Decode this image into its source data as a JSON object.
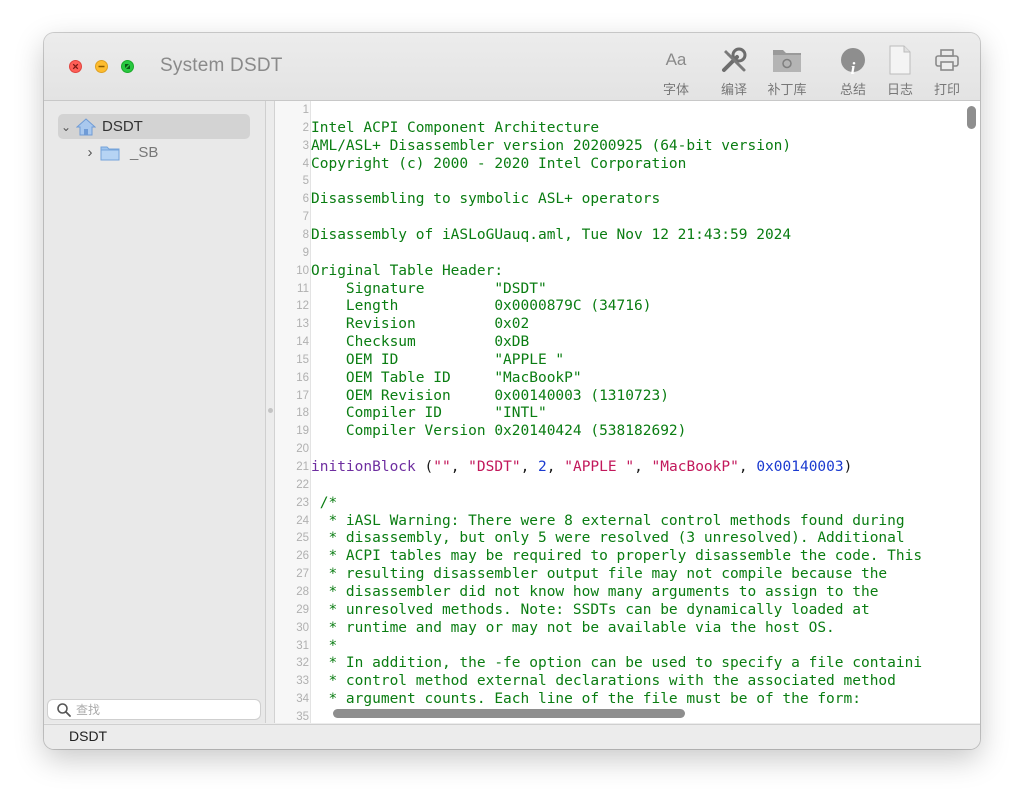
{
  "window": {
    "title": "System DSDT"
  },
  "toolbar": {
    "items": [
      {
        "label": "字体",
        "glyph": "Aa",
        "icon": "font-icon"
      },
      {
        "label": "编译",
        "icon": "wrench-screwdriver-icon"
      },
      {
        "label": "补丁库",
        "icon": "patch-folder-icon"
      },
      {
        "label": "总结",
        "glyph": "i",
        "icon": "info-icon"
      },
      {
        "label": "日志",
        "icon": "document-icon"
      },
      {
        "label": "打印",
        "icon": "printer-icon"
      }
    ]
  },
  "sidebar": {
    "tree": [
      {
        "label": "DSDT",
        "chevron": "⌄",
        "icon": "home-folder-icon"
      },
      {
        "label": "_SB",
        "chevron": "›",
        "icon": "folder-icon"
      }
    ],
    "search_placeholder": "查找"
  },
  "editor": {
    "lines": [
      {
        "n": "1",
        "segs": []
      },
      {
        "n": "2",
        "segs": [
          {
            "t": "Intel ACPI Component Architecture",
            "c": "green"
          }
        ]
      },
      {
        "n": "3",
        "segs": [
          {
            "t": "AML/ASL+ Disassembler version 20200925 (64-bit version)",
            "c": "green"
          }
        ]
      },
      {
        "n": "4",
        "segs": [
          {
            "t": "Copyright (c) 2000 - 2020 Intel Corporation",
            "c": "green"
          }
        ]
      },
      {
        "n": "5",
        "segs": []
      },
      {
        "n": "6",
        "segs": [
          {
            "t": "Disassembling to symbolic ASL+ operators",
            "c": "green"
          }
        ]
      },
      {
        "n": "7",
        "segs": []
      },
      {
        "n": "8",
        "segs": [
          {
            "t": "Disassembly of iASLoGUauq.aml, Tue Nov 12 21:43:59 2024",
            "c": "green"
          }
        ]
      },
      {
        "n": "9",
        "segs": []
      },
      {
        "n": "10",
        "segs": [
          {
            "t": "Original Table Header:",
            "c": "green"
          }
        ]
      },
      {
        "n": "11",
        "segs": [
          {
            "t": "    Signature        \"DSDT\"",
            "c": "green"
          }
        ]
      },
      {
        "n": "12",
        "segs": [
          {
            "t": "    Length           0x0000879C (34716)",
            "c": "green"
          }
        ]
      },
      {
        "n": "13",
        "segs": [
          {
            "t": "    Revision         0x02",
            "c": "green"
          }
        ]
      },
      {
        "n": "14",
        "segs": [
          {
            "t": "    Checksum         0xDB",
            "c": "green"
          }
        ]
      },
      {
        "n": "15",
        "segs": [
          {
            "t": "    OEM ID           \"APPLE \"",
            "c": "green"
          }
        ]
      },
      {
        "n": "16",
        "segs": [
          {
            "t": "    OEM Table ID     \"MacBookP\"",
            "c": "green"
          }
        ]
      },
      {
        "n": "17",
        "segs": [
          {
            "t": "    OEM Revision     0x00140003 (1310723)",
            "c": "green"
          }
        ]
      },
      {
        "n": "18",
        "segs": [
          {
            "t": "    Compiler ID      \"INTL\"",
            "c": "green"
          }
        ]
      },
      {
        "n": "19",
        "segs": [
          {
            "t": "    Compiler Version 0x20140424 (538182692)",
            "c": "green"
          }
        ]
      },
      {
        "n": "20",
        "segs": []
      },
      {
        "n": "21",
        "segs": [
          {
            "t": "initionBlock",
            "c": "purple"
          },
          {
            "t": " (",
            "c": "black"
          },
          {
            "t": "\"\"",
            "c": "red"
          },
          {
            "t": ", ",
            "c": "black"
          },
          {
            "t": "\"DSDT\"",
            "c": "red"
          },
          {
            "t": ", ",
            "c": "black"
          },
          {
            "t": "2",
            "c": "blue"
          },
          {
            "t": ", ",
            "c": "black"
          },
          {
            "t": "\"APPLE \"",
            "c": "red"
          },
          {
            "t": ", ",
            "c": "black"
          },
          {
            "t": "\"MacBookP\"",
            "c": "red"
          },
          {
            "t": ", ",
            "c": "black"
          },
          {
            "t": "0x00140003",
            "c": "blue"
          },
          {
            "t": ")",
            "c": "black"
          }
        ]
      },
      {
        "n": "22",
        "segs": []
      },
      {
        "n": "23",
        "segs": [
          {
            "t": " /*",
            "c": "green"
          }
        ]
      },
      {
        "n": "24",
        "segs": [
          {
            "t": "  * iASL Warning: There were 8 external control methods found during",
            "c": "green"
          }
        ]
      },
      {
        "n": "25",
        "segs": [
          {
            "t": "  * disassembly, but only 5 were resolved (3 unresolved). Additional",
            "c": "green"
          }
        ]
      },
      {
        "n": "26",
        "segs": [
          {
            "t": "  * ACPI tables may be required to properly disassemble the code. This",
            "c": "green"
          }
        ]
      },
      {
        "n": "27",
        "segs": [
          {
            "t": "  * resulting disassembler output file may not compile because the",
            "c": "green"
          }
        ]
      },
      {
        "n": "28",
        "segs": [
          {
            "t": "  * disassembler did not know how many arguments to assign to the",
            "c": "green"
          }
        ]
      },
      {
        "n": "29",
        "segs": [
          {
            "t": "  * unresolved methods. Note: SSDTs can be dynamically loaded at",
            "c": "green"
          }
        ]
      },
      {
        "n": "30",
        "segs": [
          {
            "t": "  * runtime and may or may not be available via the host OS.",
            "c": "green"
          }
        ]
      },
      {
        "n": "31",
        "segs": [
          {
            "t": "  *",
            "c": "green"
          }
        ]
      },
      {
        "n": "32",
        "segs": [
          {
            "t": "  * In addition, the -fe option can be used to specify a file containi",
            "c": "green"
          }
        ]
      },
      {
        "n": "33",
        "segs": [
          {
            "t": "  * control method external declarations with the associated method",
            "c": "green"
          }
        ]
      },
      {
        "n": "34",
        "segs": [
          {
            "t": "  * argument counts. Each line of the file must be of the form:",
            "c": "green"
          }
        ]
      },
      {
        "n": "35",
        "segs": []
      }
    ]
  },
  "statusbar": {
    "text": "DSDT"
  },
  "colors": {
    "comment": "#0a7d12",
    "keyword": "#6e2ea0",
    "string": "#c2185b",
    "number": "#1a3ad0",
    "close": "#fe5f57",
    "minimize": "#febc2e",
    "zoom": "#28c840"
  }
}
